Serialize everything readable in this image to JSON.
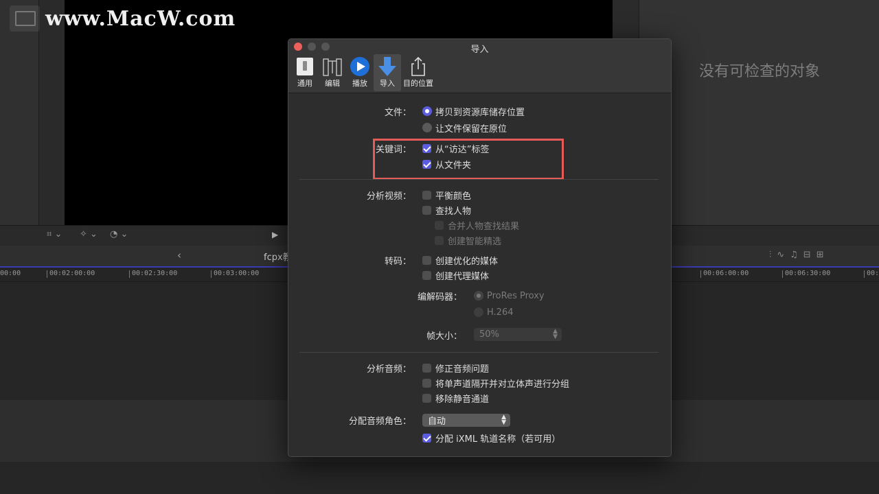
{
  "watermark": {
    "text": "www.MacW.com"
  },
  "inspector": {
    "empty_text": "没有可检查的对象"
  },
  "timeline": {
    "project_name": "fcpx教",
    "ruler_ticks": [
      "00:00",
      "00:02:00:00",
      "00:02:30:00",
      "00:03:00:00",
      "00:06:00:00",
      "00:06:30:00",
      "00:07:0"
    ]
  },
  "dialog": {
    "title": "导入",
    "tabs": [
      {
        "label": "通用",
        "icon": "general-switch-icon"
      },
      {
        "label": "编辑",
        "icon": "film-edit-icon"
      },
      {
        "label": "播放",
        "icon": "play-icon"
      },
      {
        "label": "导入",
        "icon": "import-arrow-icon"
      },
      {
        "label": "目的位置",
        "icon": "share-icon"
      }
    ],
    "files": {
      "label": "文件：",
      "copy_option": "拷贝到资源库储存位置",
      "leave_option": "让文件保留在原位"
    },
    "keywords": {
      "label": "关键词：",
      "from_finder_tags": "从“访达”标签",
      "from_folders": "从文件夹"
    },
    "analyze_video": {
      "label": "分析视频：",
      "balance_color": "平衡颜色",
      "find_people": "查找人物",
      "consolidate_people": "合并人物查找结果",
      "create_smart": "创建智能精选"
    },
    "transcode": {
      "label": "转码：",
      "optimized": "创建优化的媒体",
      "proxy": "创建代理媒体",
      "codec_label": "编解码器：",
      "codec_prores": "ProRes Proxy",
      "codec_h264": "H.264",
      "frame_size_label": "帧大小：",
      "frame_size_value": "50%"
    },
    "analyze_audio": {
      "label": "分析音频：",
      "fix_audio": "修正音频问题",
      "separate_mono": "将单声道隔开并对立体声进行分组",
      "remove_silent": "移除静音通道"
    },
    "audio_roles": {
      "label": "分配音频角色：",
      "value": "自动",
      "ixml": "分配 iXML 轨道名称（若可用）"
    }
  },
  "colors": {
    "accent": "#5b5ce0",
    "highlight": "#e55b57",
    "close": "#ec5f5a"
  }
}
